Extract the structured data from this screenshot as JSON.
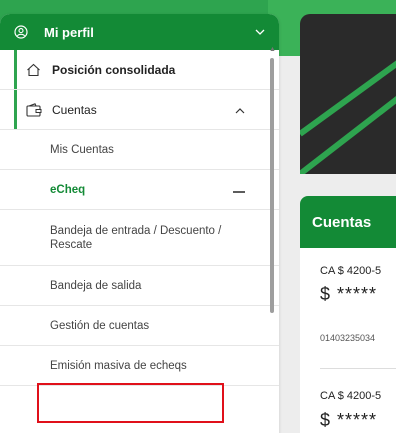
{
  "sidebar": {
    "profile_label": "Mi perfil",
    "items": [
      {
        "label": "Posición consolidada"
      },
      {
        "label": "Cuentas"
      }
    ],
    "subitems": [
      {
        "label": "Mis Cuentas"
      },
      {
        "label": "eCheq"
      },
      {
        "label": "Bandeja de entrada / Descuento / Rescate"
      },
      {
        "label": "Bandeja de salida"
      },
      {
        "label": "Gestión de cuentas"
      },
      {
        "label": "Emisión masiva de echeqs"
      }
    ]
  },
  "main": {
    "section_title": "Cuentas",
    "accounts": [
      {
        "name": "CA $ 4200-5",
        "amount": "$ *****",
        "number": "01403235034"
      },
      {
        "name": "CA $ 4200-5",
        "amount": "$ *****"
      }
    ]
  },
  "colors": {
    "brand": "#138a36",
    "accent": "#2ea44f",
    "highlight": "#e0101a"
  },
  "icons": [
    "user-icon",
    "chevron-down-icon",
    "home-icon",
    "wallet-icon",
    "chevron-up-icon",
    "minus-icon"
  ]
}
